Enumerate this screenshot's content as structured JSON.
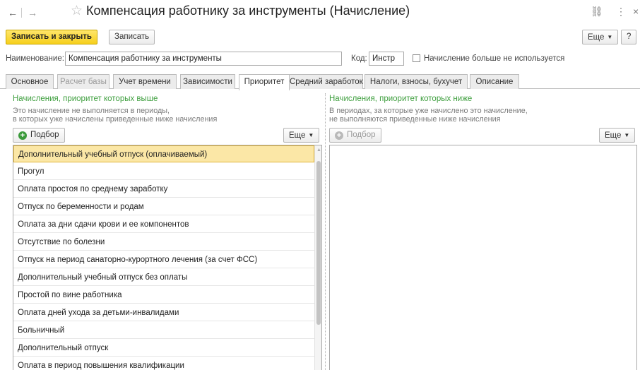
{
  "window": {
    "title": "Компенсация работнику за инструменты (Начисление)",
    "back_glyph": "←",
    "forward_glyph": "→",
    "star_glyph": "☆",
    "link_glyph": "⛓",
    "menu_glyph": "⋮",
    "close_glyph": "×"
  },
  "toolbar": {
    "save_close_label": "Записать и закрыть",
    "save_label": "Записать",
    "more_label": "Еще",
    "help_label": "?"
  },
  "form": {
    "name_label": "Наименование:",
    "name_value": "Компенсация работнику за инструменты",
    "code_label": "Код:",
    "code_value": "Инстр",
    "unused_label": "Начисление больше не используется"
  },
  "tabs": [
    {
      "label": "Основное"
    },
    {
      "label": "Расчет базы"
    },
    {
      "label": "Учет времени"
    },
    {
      "label": "Зависимости"
    },
    {
      "label": "Приоритет"
    },
    {
      "label": "Средний заработок"
    },
    {
      "label": "Налоги, взносы, бухучет"
    },
    {
      "label": "Описание"
    }
  ],
  "left_panel": {
    "heading": "Начисления, приоритет которых выше",
    "note_line1": "Это начисление не выполняется в периоды,",
    "note_line2": "в которых уже начислены приведенные ниже начисления",
    "pick_label": "Подбор",
    "more_label": "Еще",
    "items": [
      "Дополнительный учебный отпуск (оплачиваемый)",
      "Прогул",
      "Оплата простоя по среднему заработку",
      "Отпуск по беременности и родам",
      "Оплата за дни сдачи крови и ее компонентов",
      "Отсутствие по болезни",
      "Отпуск на период санаторно-курортного лечения (за счет ФСС)",
      "Дополнительный учебный отпуск без оплаты",
      "Простой по вине работника",
      "Оплата дней ухода за детьми-инвалидами",
      "Больничный",
      "Дополнительный отпуск",
      "Оплата в период повышения квалификации"
    ]
  },
  "right_panel": {
    "heading": "Начисления, приоритет которых ниже",
    "note_line1": "В периодах, за которые уже начислено это начисление,",
    "note_line2": "не выполняются приведенные ниже начисления",
    "pick_label": "Подбор",
    "more_label": "Еще"
  },
  "colors": {
    "accent_yellow": "#f6cf1c",
    "heading_green": "#3f9f3f",
    "selection": "#fbe7a6"
  }
}
